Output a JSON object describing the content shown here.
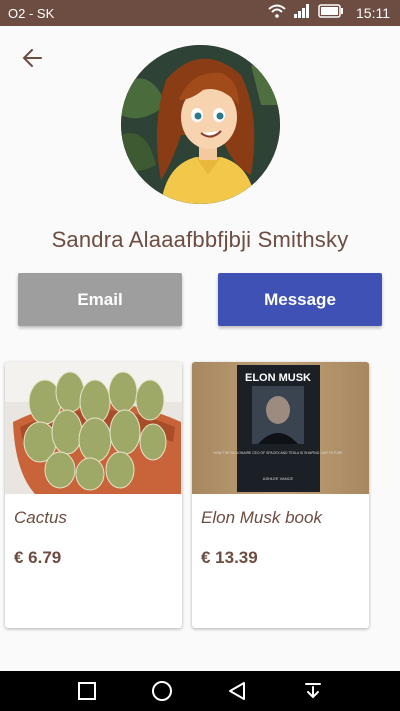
{
  "status_bar": {
    "carrier": "O2 - SK",
    "time": "15:11"
  },
  "icons": {
    "back": "arrow-back-icon",
    "wifi": "wifi-icon",
    "signal": "signal-icon",
    "battery": "battery-icon",
    "nav_recent": "square-icon",
    "nav_home": "circle-icon",
    "nav_back": "triangle-back-icon",
    "nav_notifications": "pull-down-icon"
  },
  "profile": {
    "name": "Sandra Alaaafbbfjbji Smithsky"
  },
  "actions": {
    "email_label": "Email",
    "message_label": "Message"
  },
  "items": [
    {
      "title": "Cactus",
      "price": "€ 6.79"
    },
    {
      "title": "Elon Musk book",
      "price": "€ 13.39"
    }
  ],
  "book_cover": {
    "title": "ELON MUSK",
    "subtitle": "HOW THE BILLIONAIRE CEO OF SPACEX AND TESLA IS SHAPING OUR FUTURE",
    "author": "ASHLEE VANCE"
  },
  "colors": {
    "status_bar": "#6d4c41",
    "text_brown": "#6d4c41",
    "email_button": "#9e9e9e",
    "message_button": "#3f51b5"
  }
}
